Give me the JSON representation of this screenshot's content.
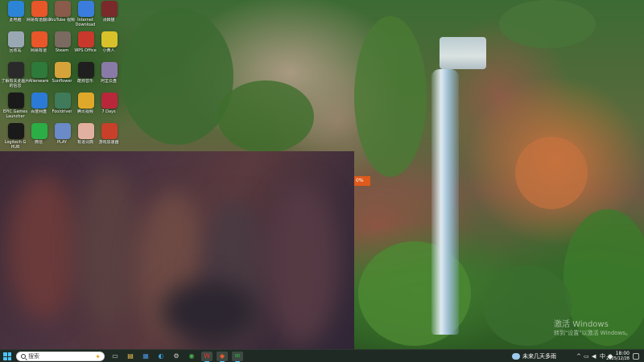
{
  "desktop": {
    "icons": [
      {
        "name": "此电脑",
        "icon": "computer-icon",
        "color": "#2b84d6"
      },
      {
        "name": "网易有道翻译",
        "icon": "translate-icon",
        "color": "#e8562a"
      },
      {
        "name": "YouTube 视频",
        "icon": "video-thumb-icon",
        "color": "#8a5a4a"
      },
      {
        "name": "Internet Download",
        "icon": "download-icon",
        "color": "#3b7ddd"
      },
      {
        "name": "汤姆猫",
        "icon": "game-thumb-icon",
        "color": "#7a2a2a"
      },
      {
        "name": "回收站",
        "icon": "recycle-bin-icon",
        "color": "#9aa8b4"
      },
      {
        "name": "网易有道",
        "icon": "youdao-icon",
        "color": "#e8562a"
      },
      {
        "name": "Steam",
        "icon": "steam-icon",
        "color": "#7a6a60"
      },
      {
        "name": "WPS Office",
        "icon": "wps-icon",
        "color": "#c8392c"
      },
      {
        "name": "小黄人",
        "icon": "minion-icon",
        "color": "#d9c12b"
      },
      {
        "name": "了解有关此图片的信息",
        "icon": "info-icon",
        "color": "#2a2a2a"
      },
      {
        "name": "Alienware",
        "icon": "alienware-icon",
        "color": "#2d7a3a"
      },
      {
        "name": "Sunflower",
        "icon": "folder-icon",
        "color": "#d6a23a"
      },
      {
        "name": "酷狗音乐",
        "icon": "music-icon",
        "color": "#1f1f1f"
      },
      {
        "name": "阿里云盘",
        "icon": "cloud-icon",
        "color": "#8a7aa8"
      },
      {
        "name": "EPIC Games Launcher",
        "icon": "epic-icon",
        "color": "#1a1a1a"
      },
      {
        "name": "百度网盘",
        "icon": "baidu-netdisk-icon",
        "color": "#2b7ad6"
      },
      {
        "name": "Fooldriver",
        "icon": "driver-icon",
        "color": "#3f7a5a"
      },
      {
        "name": "腾讯视频",
        "icon": "owl-icon",
        "color": "#e0a82a"
      },
      {
        "name": "7 Days",
        "icon": "days-icon",
        "color": "#b8283a"
      },
      {
        "name": "Logitech G HUB",
        "icon": "logitech-icon",
        "color": "#1a1a1a"
      },
      {
        "name": "微信",
        "icon": "wechat-icon",
        "color": "#2aae45"
      },
      {
        "name": "PLAY",
        "icon": "play-icon",
        "color": "#6a8ac8"
      },
      {
        "name": "有道词典",
        "icon": "piggy-icon",
        "color": "#e2b0a0"
      },
      {
        "name": "游戏加速器",
        "icon": "game-icon",
        "color": "#c8402a"
      }
    ]
  },
  "overlay": {
    "orange_tab": "0%"
  },
  "watermark": {
    "line1": "激活 Windows",
    "line2": "转到\"设置\"以激活 Windows。"
  },
  "taskbar": {
    "search_placeholder": "搜索",
    "apps": [
      {
        "name": "task-view",
        "glyph": "▭"
      },
      {
        "name": "file-explorer",
        "glyph": "▤"
      },
      {
        "name": "microsoft-store",
        "glyph": "▦"
      },
      {
        "name": "edge-browser",
        "glyph": "◐"
      },
      {
        "name": "settings",
        "glyph": "⚙"
      },
      {
        "name": "chrome-browser",
        "glyph": "◉"
      },
      {
        "name": "wps-office",
        "glyph": "W"
      },
      {
        "name": "youdao",
        "glyph": "◆"
      },
      {
        "name": "wechat",
        "glyph": "✉"
      }
    ],
    "weather_text": "未来几天多雨",
    "tray": {
      "lang": "中"
    },
    "time": "18:00",
    "date": "2025/12/28"
  },
  "colors": {
    "accent": "#4cc2ff",
    "taskbar_bg": "#202a24"
  }
}
